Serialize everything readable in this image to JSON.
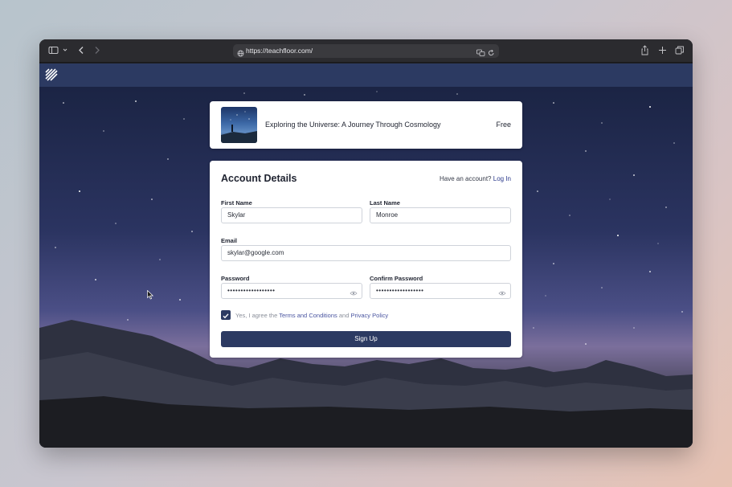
{
  "browser": {
    "url": "https://teachfloor.com/"
  },
  "course": {
    "title": "Exploring the Universe: A Journey Through Cosmology",
    "price": "Free"
  },
  "form": {
    "title": "Account Details",
    "have_account": "Have an account?",
    "login_link": "Log In",
    "first_name": {
      "label": "First Name",
      "value": "Skylar"
    },
    "last_name": {
      "label": "Last Name",
      "value": "Monroe"
    },
    "email": {
      "label": "Email",
      "value": "skylar@google.com"
    },
    "password": {
      "label": "Password",
      "value": "••••••••••••••••••"
    },
    "confirm_password": {
      "label": "Confirm Password",
      "value": "••••••••••••••••••"
    },
    "agree": {
      "checked": true,
      "prefix": "Yes, I agree the",
      "terms": "Terms and Conditions",
      "and": "and",
      "privacy": "Privacy Policy"
    },
    "submit_label": "Sign Up"
  },
  "colors": {
    "accent": "#2c3a62",
    "link": "#4a55a0"
  }
}
